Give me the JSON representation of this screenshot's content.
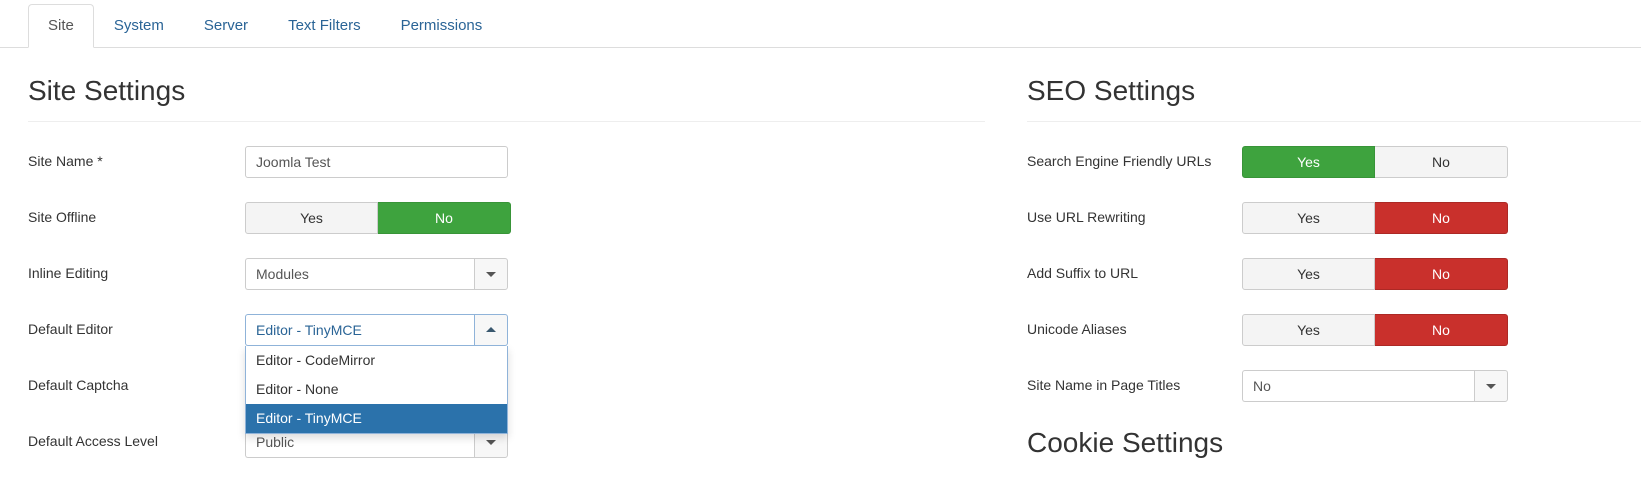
{
  "tabs": [
    {
      "label": "Site",
      "active": true
    },
    {
      "label": "System",
      "active": false
    },
    {
      "label": "Server",
      "active": false
    },
    {
      "label": "Text Filters",
      "active": false
    },
    {
      "label": "Permissions",
      "active": false
    }
  ],
  "site_settings": {
    "title": "Site Settings",
    "site_name": {
      "label": "Site Name *",
      "value": "Joomla Test"
    },
    "site_offline": {
      "label": "Site Offline",
      "yes": "Yes",
      "no": "No",
      "selected": "No"
    },
    "inline_editing": {
      "label": "Inline Editing",
      "value": "Modules"
    },
    "default_editor": {
      "label": "Default Editor",
      "value": "Editor - TinyMCE",
      "open": true,
      "options": [
        "Editor - CodeMirror",
        "Editor - None",
        "Editor - TinyMCE"
      ],
      "selected_option": "Editor - TinyMCE"
    },
    "default_captcha": {
      "label": "Default Captcha"
    },
    "default_access_level": {
      "label": "Default Access Level",
      "value": "Public"
    }
  },
  "seo_settings": {
    "title": "SEO Settings",
    "sef_urls": {
      "label": "Search Engine Friendly URLs",
      "yes": "Yes",
      "no": "No",
      "selected": "Yes"
    },
    "url_rewriting": {
      "label": "Use URL Rewriting",
      "yes": "Yes",
      "no": "No",
      "selected": "No"
    },
    "add_suffix": {
      "label": "Add Suffix to URL",
      "yes": "Yes",
      "no": "No",
      "selected": "No"
    },
    "unicode_aliases": {
      "label": "Unicode Aliases",
      "yes": "Yes",
      "no": "No",
      "selected": "No"
    },
    "site_name_in_titles": {
      "label": "Site Name in Page Titles",
      "value": "No"
    }
  },
  "cookie_settings": {
    "title": "Cookie Settings"
  },
  "colors": {
    "active_green": "#3eA33e",
    "active_red": "#c9302c",
    "link_blue": "#2a6496",
    "highlight_blue": "#2b72ab"
  }
}
